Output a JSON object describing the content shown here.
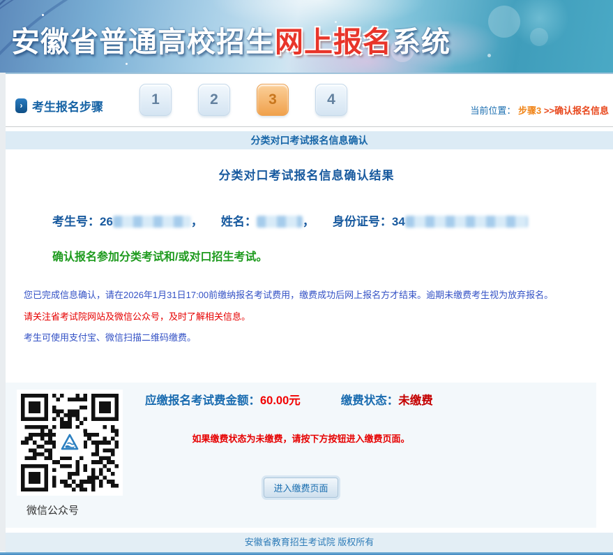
{
  "header": {
    "title_part1": "安徽省普通高校招生",
    "title_highlight": "网上报名",
    "title_part2": "系统"
  },
  "steps_bar": {
    "label": "考生报名步骤",
    "steps": [
      {
        "num": "1",
        "active": false
      },
      {
        "num": "2",
        "active": false
      },
      {
        "num": "3",
        "active": true
      },
      {
        "num": "4",
        "active": false
      }
    ],
    "location": {
      "prefix": "当前位置：",
      "step": "步骤3 ",
      "page": ">>确认报名信息"
    }
  },
  "section_bar": {
    "title": "分类对口考试报名信息确认"
  },
  "result": {
    "title": "分类对口考试报名信息确认结果",
    "exam_no_label": "考生号：",
    "exam_no_prefix": "26",
    "comma1": "，",
    "name_label": "姓名：",
    "comma2": "，",
    "id_label": "身份证号：",
    "id_prefix": "34",
    "confirm_text": "确认报名参加分类考试和/或对口招生考试。"
  },
  "notices": {
    "blue1": "您已完成信息确认，请在2026年1月31日17:00前缴纳报名考试费用，缴费成功后网上报名方才结束。逾期未缴费考生视为放弃报名。",
    "red1": "请关注省考试院网站及微信公众号，及时了解相关信息。",
    "blue2": "考生可使用支付宝、微信扫描二维码缴费。"
  },
  "payment": {
    "amount_label": "应缴报名考试费金额：",
    "amount_value": "60.00元",
    "status_label": "缴费状态：",
    "status_value": "未缴费",
    "note": "如果缴费状态为未缴费，请按下方按钮进入缴费页面。",
    "button_label": "进入缴费页面",
    "qr_caption": "微信公众号"
  },
  "footer": {
    "copyright": "安徽省教育招生考试院 版权所有"
  },
  "colors": {
    "header_red": "#e8352a",
    "primary_blue": "#17599e",
    "notice_blue": "#3351c5",
    "notice_red": "#e60000",
    "amount_red": "#f20000",
    "status_red": "#c40000",
    "confirm_green": "#1d9a1d",
    "step_active_orange": "#f0a14c"
  }
}
